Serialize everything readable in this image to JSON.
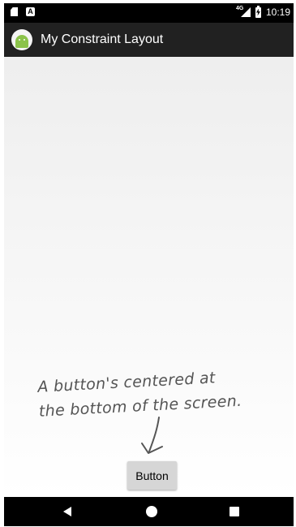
{
  "status_bar": {
    "time": "10:19",
    "network": "4G"
  },
  "app_bar": {
    "title": "My Constraint Layout",
    "icon": "android-app-icon"
  },
  "annotation": {
    "line1": "A button's centered at",
    "line2": "the bottom of the screen."
  },
  "main": {
    "button_label": "Button"
  },
  "nav_bar": {
    "back": "back-icon",
    "home": "home-icon",
    "recents": "recents-icon"
  }
}
